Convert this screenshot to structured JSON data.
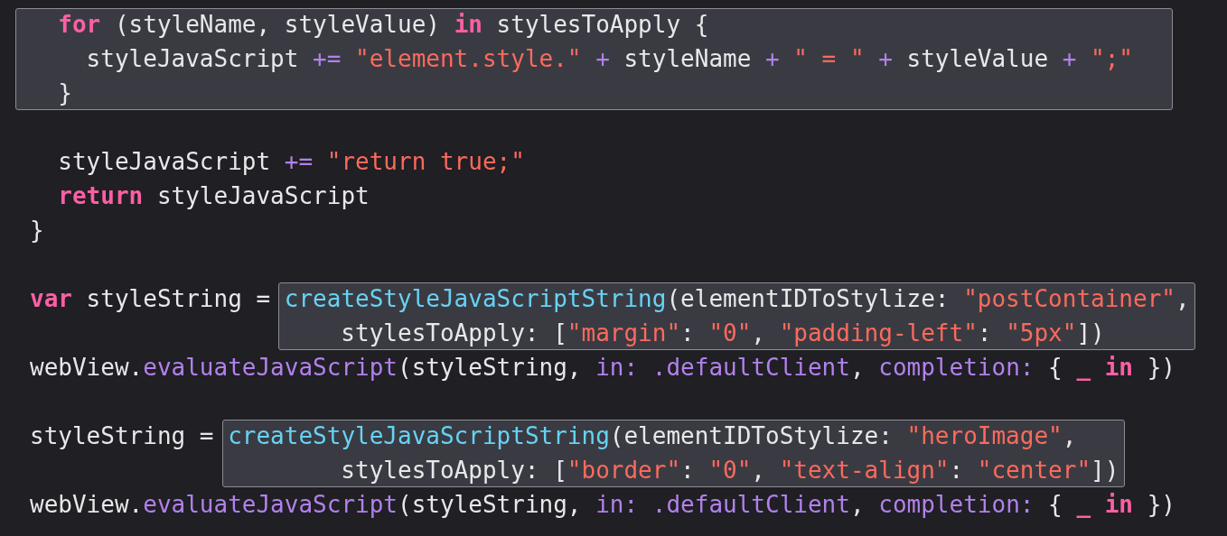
{
  "code": {
    "lines": [
      {
        "kind": "code",
        "segments": [
          {
            "highlighted": true,
            "tokens": [
              {
                "text": "  for",
                "kind": "keyword"
              },
              {
                "text": " (styleName, styleValue) ",
                "kind": "plain"
              },
              {
                "text": "in",
                "kind": "keyword"
              },
              {
                "text": " stylesToApply {",
                "kind": "plain"
              }
            ]
          }
        ]
      },
      {
        "kind": "code",
        "segments": [
          {
            "highlighted": true,
            "tokens": [
              {
                "text": "    styleJavaScript ",
                "kind": "plain"
              },
              {
                "text": "+=",
                "kind": "operator"
              },
              {
                "text": " \"element.style.\" ",
                "kind": "string"
              },
              {
                "text": "+",
                "kind": "operator"
              },
              {
                "text": " styleName ",
                "kind": "plain"
              },
              {
                "text": "+",
                "kind": "operator"
              },
              {
                "text": " \" = \" ",
                "kind": "string"
              },
              {
                "text": "+",
                "kind": "operator"
              },
              {
                "text": " styleValue ",
                "kind": "plain"
              },
              {
                "text": "+",
                "kind": "operator"
              },
              {
                "text": " \";\"",
                "kind": "string"
              }
            ]
          }
        ]
      },
      {
        "kind": "code",
        "segments": [
          {
            "highlighted": true,
            "tokens": [
              {
                "text": "  }",
                "kind": "plain"
              }
            ]
          }
        ]
      },
      {
        "kind": "blank"
      },
      {
        "kind": "code",
        "segments": [
          {
            "highlighted": false,
            "tokens": [
              {
                "text": "  styleJavaScript ",
                "kind": "plain"
              },
              {
                "text": "+=",
                "kind": "operator"
              },
              {
                "text": " \"return true;\"",
                "kind": "string"
              }
            ]
          }
        ]
      },
      {
        "kind": "code",
        "segments": [
          {
            "highlighted": false,
            "tokens": [
              {
                "text": "  return",
                "kind": "keyword"
              },
              {
                "text": " styleJavaScript",
                "kind": "plain"
              }
            ]
          }
        ]
      },
      {
        "kind": "code",
        "segments": [
          {
            "highlighted": false,
            "tokens": [
              {
                "text": "}",
                "kind": "plain"
              }
            ]
          }
        ]
      },
      {
        "kind": "blank"
      },
      {
        "kind": "code",
        "segments": [
          {
            "highlighted": false,
            "tokens": [
              {
                "text": "var",
                "kind": "keyword"
              },
              {
                "text": " styleString = ",
                "kind": "plain"
              }
            ]
          },
          {
            "highlighted": true,
            "tokens": [
              {
                "text": "createStyleJavaScriptString",
                "kind": "call"
              },
              {
                "text": "(elementIDToStylize: ",
                "kind": "plain"
              },
              {
                "text": "\"postContainer\"",
                "kind": "string"
              },
              {
                "text": ",",
                "kind": "plain"
              }
            ]
          }
        ]
      },
      {
        "kind": "code",
        "segments": [
          {
            "highlighted": true,
            "tokens": [
              {
                "text": "                      stylesToApply: [",
                "kind": "plain"
              },
              {
                "text": "\"margin\"",
                "kind": "string"
              },
              {
                "text": ": ",
                "kind": "plain"
              },
              {
                "text": "\"0\"",
                "kind": "string"
              },
              {
                "text": ", ",
                "kind": "plain"
              },
              {
                "text": "\"padding-left\"",
                "kind": "string"
              },
              {
                "text": ": ",
                "kind": "plain"
              },
              {
                "text": "\"5px\"",
                "kind": "string"
              },
              {
                "text": "])",
                "kind": "plain"
              }
            ]
          }
        ]
      },
      {
        "kind": "code",
        "segments": [
          {
            "highlighted": false,
            "tokens": [
              {
                "text": "webView.",
                "kind": "plain"
              },
              {
                "text": "evaluateJavaScript",
                "kind": "method"
              },
              {
                "text": "(styleString, ",
                "kind": "plain"
              },
              {
                "text": "in:",
                "kind": "method"
              },
              {
                "text": " .defaultClient",
                "kind": "method"
              },
              {
                "text": ", ",
                "kind": "plain"
              },
              {
                "text": "completion:",
                "kind": "method"
              },
              {
                "text": " { ",
                "kind": "plain"
              },
              {
                "text": "_",
                "kind": "keyword"
              },
              {
                "text": " in",
                "kind": "keyword"
              },
              {
                "text": " })",
                "kind": "plain"
              }
            ]
          }
        ]
      },
      {
        "kind": "blank"
      },
      {
        "kind": "code",
        "segments": [
          {
            "highlighted": false,
            "tokens": [
              {
                "text": "styleString = ",
                "kind": "plain"
              }
            ]
          },
          {
            "highlighted": true,
            "tokens": [
              {
                "text": "createStyleJavaScriptString",
                "kind": "call"
              },
              {
                "text": "(elementIDToStylize: ",
                "kind": "plain"
              },
              {
                "text": "\"heroImage\"",
                "kind": "string"
              },
              {
                "text": ",",
                "kind": "plain"
              }
            ]
          }
        ]
      },
      {
        "kind": "code",
        "segments": [
          {
            "highlighted": true,
            "tokens": [
              {
                "text": "                      stylesToApply: [",
                "kind": "plain"
              },
              {
                "text": "\"border\"",
                "kind": "string"
              },
              {
                "text": ": ",
                "kind": "plain"
              },
              {
                "text": "\"0\"",
                "kind": "string"
              },
              {
                "text": ", ",
                "kind": "plain"
              },
              {
                "text": "\"text-align\"",
                "kind": "string"
              },
              {
                "text": ": ",
                "kind": "plain"
              },
              {
                "text": "\"center\"",
                "kind": "string"
              },
              {
                "text": "])",
                "kind": "plain"
              }
            ]
          }
        ]
      },
      {
        "kind": "code",
        "segments": [
          {
            "highlighted": false,
            "tokens": [
              {
                "text": "webView.",
                "kind": "plain"
              },
              {
                "text": "evaluateJavaScript",
                "kind": "method"
              },
              {
                "text": "(styleString, ",
                "kind": "plain"
              },
              {
                "text": "in:",
                "kind": "method"
              },
              {
                "text": " .defaultClient",
                "kind": "method"
              },
              {
                "text": ", ",
                "kind": "plain"
              },
              {
                "text": "completion:",
                "kind": "method"
              },
              {
                "text": " { ",
                "kind": "plain"
              },
              {
                "text": "_",
                "kind": "keyword"
              },
              {
                "text": " in",
                "kind": "keyword"
              },
              {
                "text": " })",
                "kind": "plain"
              }
            ]
          }
        ]
      }
    ]
  }
}
